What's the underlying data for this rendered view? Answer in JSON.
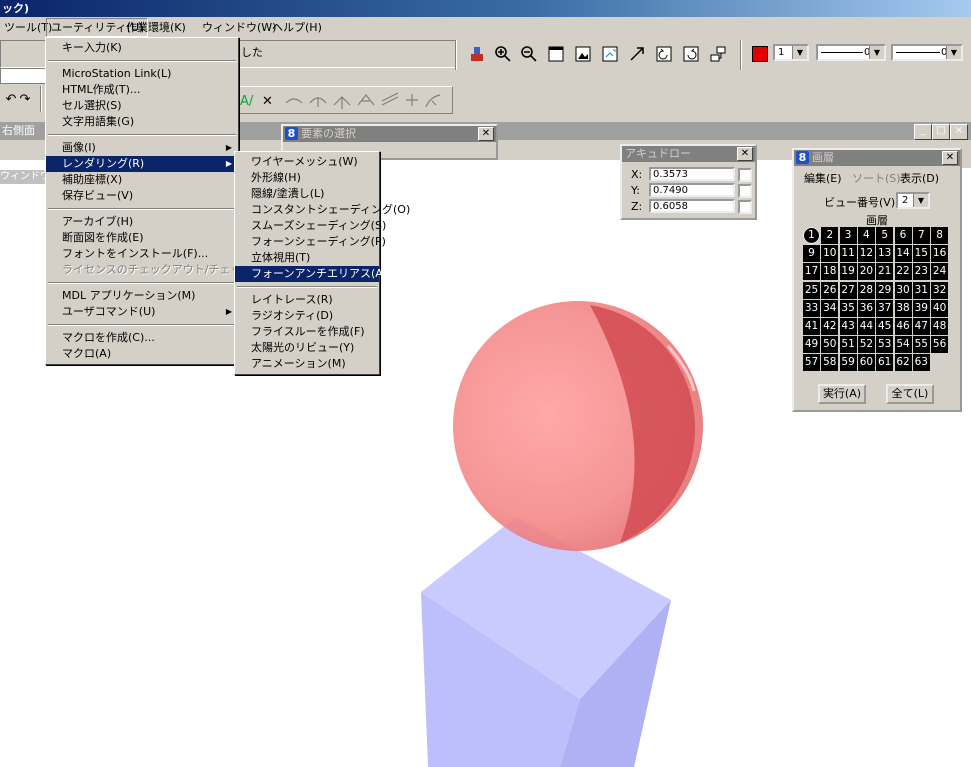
{
  "window": {
    "title_fragment": "ック)"
  },
  "menubar": {
    "items": [
      {
        "label": "ツール(T)"
      },
      {
        "label": "ユーティリティ(U)"
      },
      {
        "label": "作業環境(K)"
      },
      {
        "label": "ウィンドウ(W)"
      },
      {
        "label": "ヘルプ(H)"
      }
    ]
  },
  "status": {
    "message_fragment": "した"
  },
  "toolbar": {
    "color_value": "",
    "color_swatch": "#e00000",
    "weight_value": "1",
    "style_value": "0",
    "line_value": "0"
  },
  "view_window": {
    "title": "右側面",
    "status_label": "ウィンドウ2-",
    "controls": [
      "_",
      "□",
      "×"
    ]
  },
  "utility_menu": {
    "items": [
      {
        "label": "キー入力(K)"
      },
      {
        "label": "MicroStation Link(L)"
      },
      {
        "label": "HTML作成(T)..."
      },
      {
        "label": "セル選択(S)"
      },
      {
        "label": "文字用語集(G)"
      },
      {
        "label": "画像(I)"
      },
      {
        "label": "レンダリング(R)"
      },
      {
        "label": "補助座標(X)"
      },
      {
        "label": "保存ビュー(V)"
      },
      {
        "label": "アーカイブ(H)"
      },
      {
        "label": "断面図を作成(E)"
      },
      {
        "label": "フォントをインストール(F)..."
      },
      {
        "label": "ライセンスのチェックアウト/チェックイン(N)"
      },
      {
        "label": "MDL アプリケーション(M)"
      },
      {
        "label": "ユーザコマンド(U)"
      },
      {
        "label": "マクロを作成(C)..."
      },
      {
        "label": "マクロ(A)"
      }
    ]
  },
  "render_menu": {
    "items": [
      {
        "label": "ワイヤーメッシュ(W)"
      },
      {
        "label": "外形線(H)"
      },
      {
        "label": "隠線/塗潰し(L)"
      },
      {
        "label": "コンスタントシェーディング(O)"
      },
      {
        "label": "スムーズシェーディング(S)"
      },
      {
        "label": "フォーンシェーディング(P)"
      },
      {
        "label": "立体視用(T)"
      },
      {
        "label": "フォーンアンチエリアス(A)"
      },
      {
        "label": "レイトレース(R)"
      },
      {
        "label": "ラジオシティ(D)"
      },
      {
        "label": "フライスルーを作成(F)"
      },
      {
        "label": "太陽光のリビュー(Y)"
      },
      {
        "label": "アニメーション(M)"
      }
    ]
  },
  "element_select": {
    "title": "要素の選択"
  },
  "accudraw": {
    "title": "アキュドロー",
    "x_label": "X:",
    "x_value": "0.3573",
    "y_label": "Y:",
    "y_value": "0.7490",
    "z_label": "Z:",
    "z_value": "0.6058"
  },
  "levels": {
    "title": "画層",
    "menu_edit": "編集(E)",
    "menu_sort": "ソート(S)",
    "menu_view": "表示(D)",
    "view_number_label": "ビュー番号(V):",
    "view_number_value": "2",
    "grid_label": "画層",
    "apply_button": "実行(A)",
    "all_button": "全て(L)",
    "grid": [
      "1",
      "2",
      "3",
      "4",
      "5",
      "6",
      "7",
      "8",
      "9",
      "10",
      "11",
      "12",
      "13",
      "14",
      "15",
      "16",
      "17",
      "18",
      "19",
      "20",
      "21",
      "22",
      "23",
      "24",
      "25",
      "26",
      "27",
      "28",
      "29",
      "30",
      "31",
      "32",
      "33",
      "34",
      "35",
      "36",
      "37",
      "38",
      "39",
      "40",
      "41",
      "42",
      "43",
      "44",
      "45",
      "46",
      "47",
      "48",
      "49",
      "50",
      "51",
      "52",
      "53",
      "54",
      "55",
      "56",
      "57",
      "58",
      "59",
      "60",
      "61",
      "62",
      "63"
    ]
  },
  "scene": {
    "sphere_color": "#e85a5a",
    "cube_color": "#9a9ef8"
  }
}
